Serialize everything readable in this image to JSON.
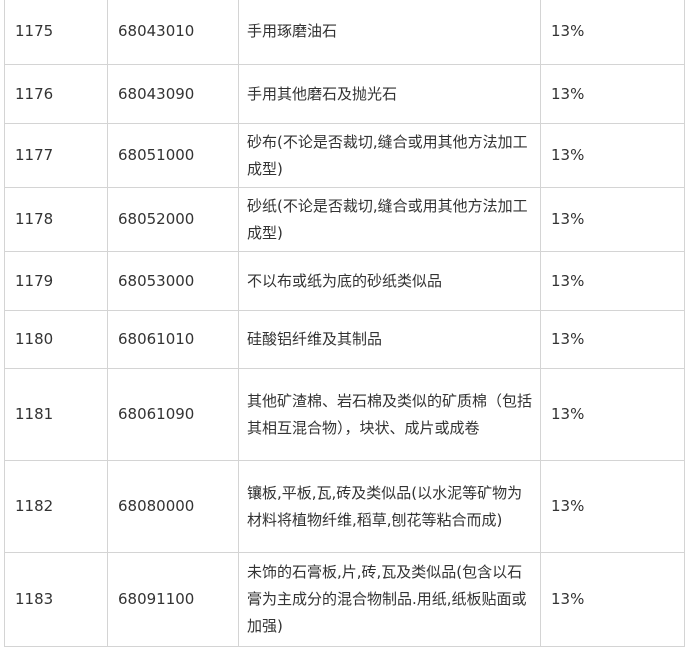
{
  "table": {
    "rows": [
      {
        "no": "1175",
        "code": "68043010",
        "desc": "手用琢磨油石",
        "rate": "13%"
      },
      {
        "no": "1176",
        "code": "68043090",
        "desc": "手用其他磨石及抛光石",
        "rate": "13%"
      },
      {
        "no": "1177",
        "code": "68051000",
        "desc": "砂布(不论是否裁切,缝合或用其他方法加工成型)",
        "rate": "13%"
      },
      {
        "no": "1178",
        "code": "68052000",
        "desc": "砂纸(不论是否裁切,缝合或用其他方法加工成型)",
        "rate": "13%"
      },
      {
        "no": "1179",
        "code": "68053000",
        "desc": "不以布或纸为底的砂纸类似品",
        "rate": "13%"
      },
      {
        "no": "1180",
        "code": "68061010",
        "desc": "硅酸铝纤维及其制品",
        "rate": "13%"
      },
      {
        "no": "1181",
        "code": "68061090",
        "desc": "其他矿渣棉、岩石棉及类似的矿质棉（包括其相互混合物），块状、成片或成卷",
        "rate": "13%"
      },
      {
        "no": "1182",
        "code": "68080000",
        "desc": "镶板,平板,瓦,砖及类似品(以水泥等矿物为材料将植物纤维,稻草,刨花等粘合而成)",
        "rate": "13%"
      },
      {
        "no": "1183",
        "code": "68091100",
        "desc": "未饰的石膏板,片,砖,瓦及类似品(包含以石膏为主成分的混合物制品.用纸,纸板贴面或加强)",
        "rate": "13%"
      }
    ]
  }
}
